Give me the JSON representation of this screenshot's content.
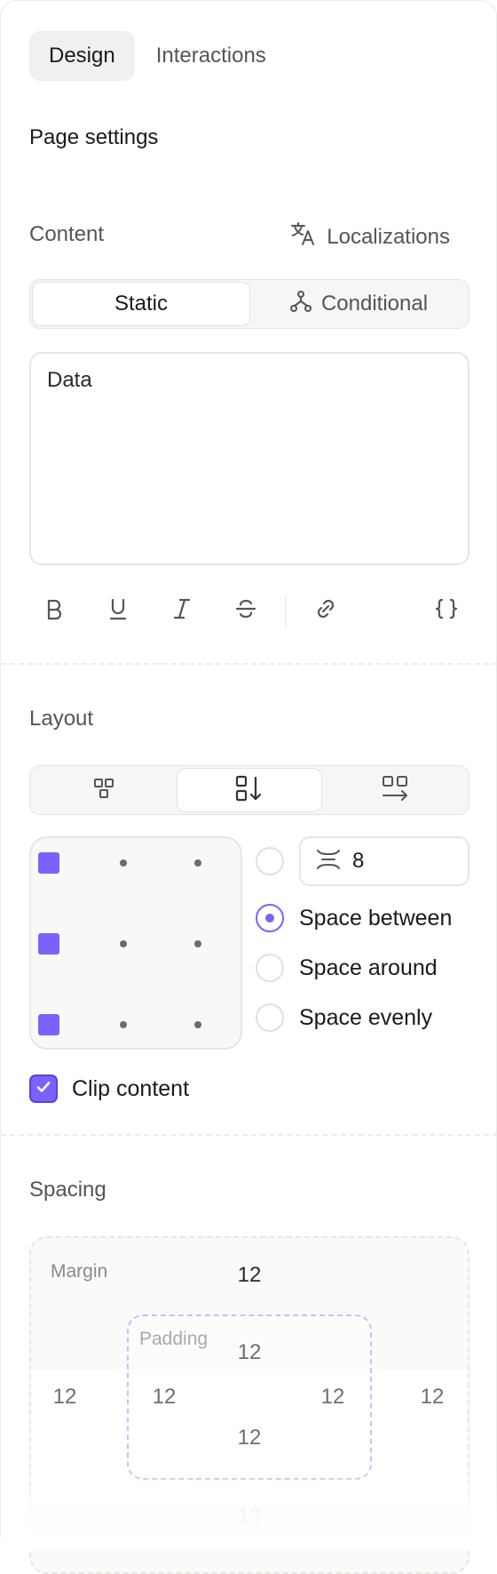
{
  "tabs": [
    {
      "label": "Design",
      "active": true
    },
    {
      "label": "Interactions",
      "active": false
    }
  ],
  "page_settings": "Page settings",
  "content": {
    "label": "Content",
    "localizations": "Localizations",
    "modes": [
      {
        "label": "Static",
        "active": true
      },
      {
        "label": "Conditional",
        "active": false
      }
    ],
    "text_value": "Data",
    "toolbar": [
      "bold-icon",
      "underline-icon",
      "italic-icon",
      "strikethrough-icon",
      "link-icon",
      "braces-icon"
    ]
  },
  "layout": {
    "label": "Layout",
    "direction_options": [
      "free-layout-icon",
      "vertical-stack-icon",
      "horizontal-stack-icon"
    ],
    "active_direction": "vertical-stack-icon",
    "alignment_selected_column": "left",
    "gap_value": "8",
    "distribution_options": [
      {
        "label": "Space between",
        "selected": true
      },
      {
        "label": "Space around",
        "selected": false
      },
      {
        "label": "Space evenly",
        "selected": false
      }
    ],
    "clip_content": {
      "label": "Clip content",
      "checked": true
    }
  },
  "spacing": {
    "label": "Spacing",
    "margin": {
      "label": "Margin",
      "top": "12",
      "left": "12",
      "right": "12",
      "bottom": "12"
    },
    "padding": {
      "label": "Padding",
      "top": "12",
      "left": "12",
      "right": "12",
      "bottom": "12"
    }
  },
  "colors": {
    "accent": "#7b61ff",
    "padding_border": "#c8bfff",
    "muted_text": "#555555"
  }
}
